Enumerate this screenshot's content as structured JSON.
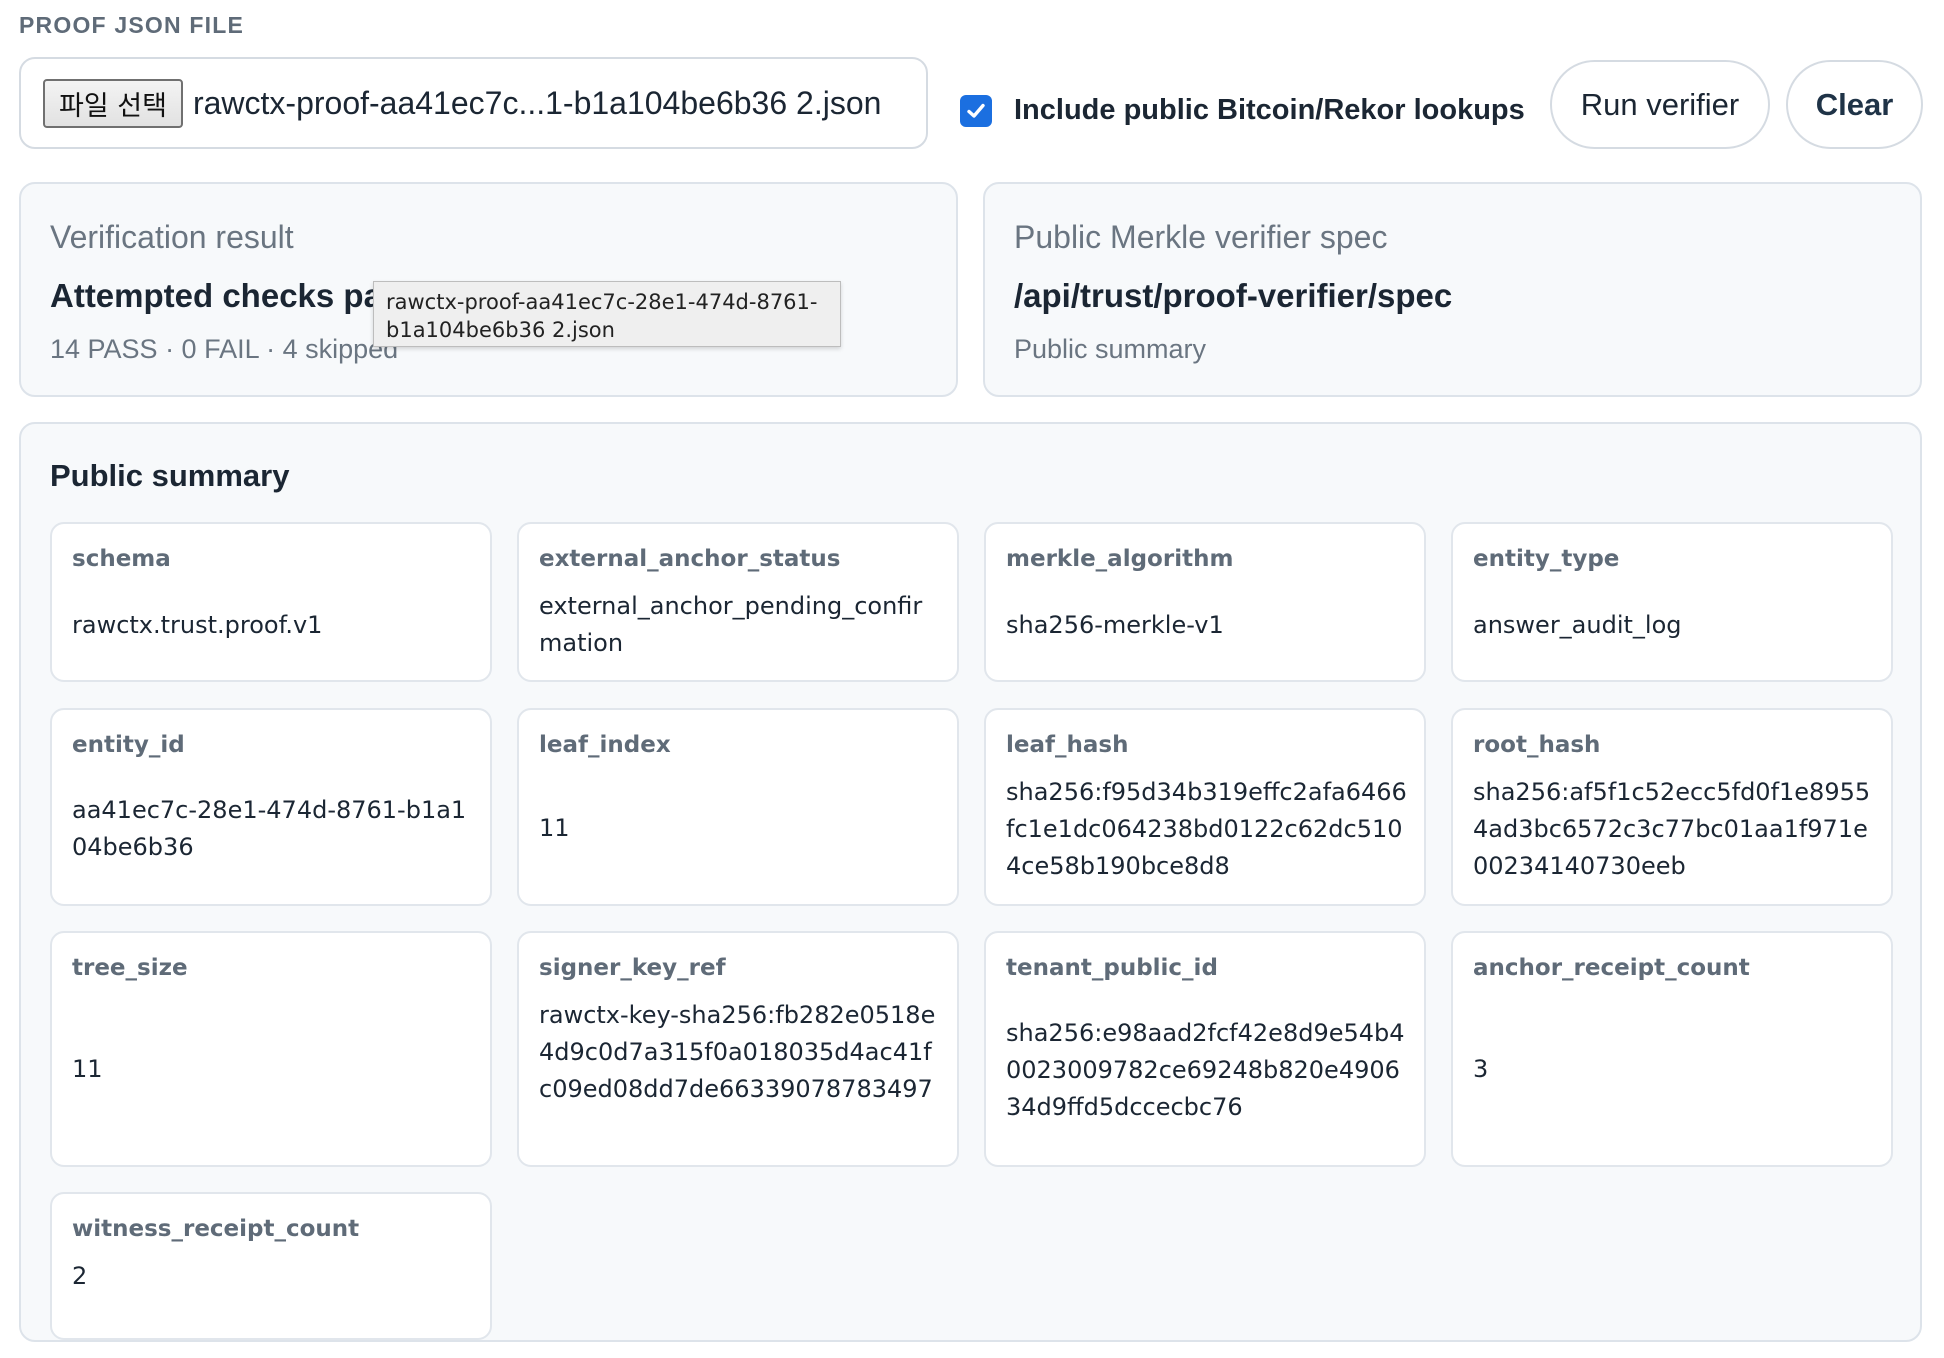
{
  "header": {
    "section_label": "PROOF JSON FILE",
    "file_button": "파일 선택",
    "file_name": "rawctx-proof-aa41ec7c...1-b1a104be6b36 2.json",
    "include_lookups_label": "Include public Bitcoin/Rekor lookups",
    "include_lookups_checked": true,
    "run_label": "Run verifier",
    "clear_label": "Clear"
  },
  "verification": {
    "title": "Verification result",
    "headline": "Attempted checks pa",
    "summary": "14 PASS · 0 FAIL · 4 skipped"
  },
  "tooltip": {
    "text": "rawctx-proof-aa41ec7c-28e1-474d-8761-b1a104be6b36 2.json"
  },
  "spec": {
    "title": "Public Merkle verifier spec",
    "path": "/api/trust/proof-verifier/spec",
    "subtitle": "Public summary"
  },
  "summary": {
    "title": "Public summary",
    "fields": [
      {
        "key": "schema",
        "value": "rawctx.trust.proof.v1"
      },
      {
        "key": "external_anchor_status",
        "value": "external_anchor_pending_confirmation"
      },
      {
        "key": "merkle_algorithm",
        "value": "sha256-merkle-v1"
      },
      {
        "key": "entity_type",
        "value": "answer_audit_log"
      },
      {
        "key": "entity_id",
        "value": "aa41ec7c-28e1-474d-8761-b1a104be6b36"
      },
      {
        "key": "leaf_index",
        "value": "11"
      },
      {
        "key": "leaf_hash",
        "value": "sha256:f95d34b319effc2afa6466fc1e1dc064238bd0122c62dc5104ce58b190bce8d8"
      },
      {
        "key": "root_hash",
        "value": "sha256:af5f1c52ecc5fd0f1e89554ad3bc6572c3c77bc01aa1f971e00234140730eeb"
      },
      {
        "key": "tree_size",
        "value": "11"
      },
      {
        "key": "signer_key_ref",
        "value": "rawctx-key-sha256:fb282e0518e4d9c0d7a315f0a018035d4ac41fc09ed08dd7de66339078783497"
      },
      {
        "key": "tenant_public_id",
        "value": "sha256:e98aad2fcf42e8d9e54b40023009782ce69248b820e490634d9ffd5dccecbc76"
      },
      {
        "key": "anchor_receipt_count",
        "value": "3"
      },
      {
        "key": "witness_receipt_count",
        "value": "2"
      }
    ]
  }
}
